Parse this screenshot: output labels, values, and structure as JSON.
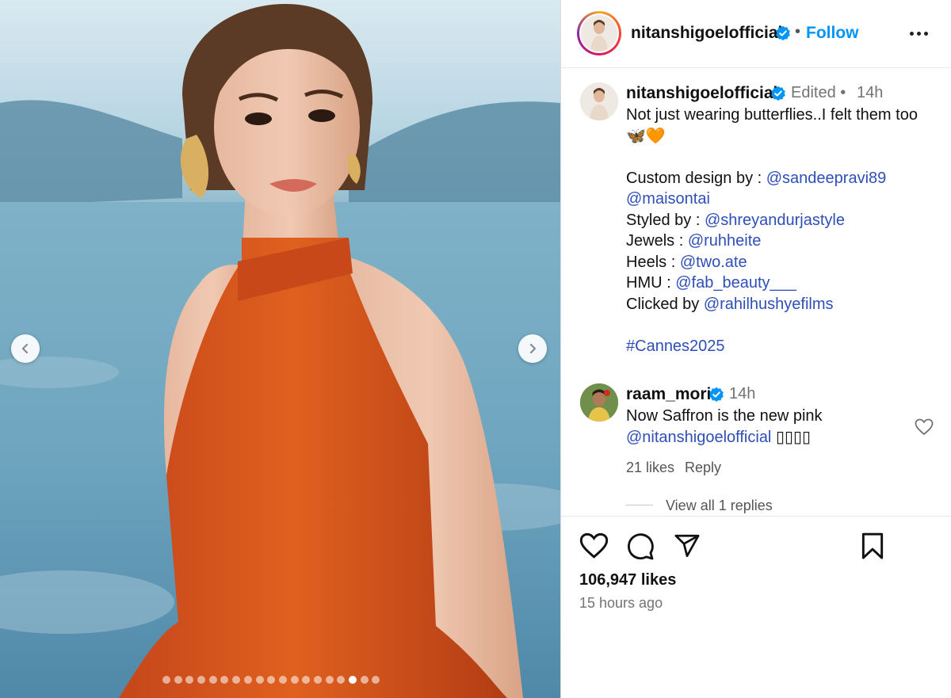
{
  "post": {
    "username": "nitanshigoelofficial",
    "follow_label": "Follow",
    "separator": "•",
    "carousel": {
      "slide_count": 19,
      "active_index": 16
    }
  },
  "caption": {
    "username": "nitanshigoelofficial",
    "edited": "Edited",
    "dot": "•",
    "time": "14h",
    "line1": "Not just wearing butterflies..I felt them too",
    "emoji": "🦋🧡",
    "design_label": "Custom design by : ",
    "design_mention1": "@sandeepravi89",
    "design_mention2": "@maisontai",
    "styled_label": "Styled by : ",
    "styled_mention": "@shreyandurjastyle",
    "jewels_label": "Jewels : ",
    "jewels_mention": "@ruhheite",
    "heels_label": "Heels : ",
    "heels_mention": "@two.ate",
    "hmu_label": "HMU : ",
    "hmu_mention": "@fab_beauty___",
    "clicked_label": "Clicked by ",
    "clicked_mention": "@rahilhushyefilms",
    "hashtag": "#Cannes2025"
  },
  "comment": {
    "username": "raam_mori",
    "time": "14h",
    "text": "Now Saffron is the new pink",
    "mention": "@nitanshigoelofficial",
    "trailing": "▯▯▯▯",
    "likes": "21 likes",
    "reply": "Reply",
    "view_replies": "View all 1 replies"
  },
  "stats": {
    "likes": "106,947 likes",
    "posted": "15 hours ago"
  },
  "colors": {
    "accent": "#0095f6",
    "mention": "#2f4fb8",
    "secondary_text": "#737373",
    "dress": "#d9531e"
  },
  "icons": [
    "prev-arrow-icon",
    "next-arrow-icon",
    "verified-badge-icon",
    "more-options-icon",
    "heart-icon",
    "comment-icon",
    "share-icon",
    "bookmark-icon"
  ]
}
